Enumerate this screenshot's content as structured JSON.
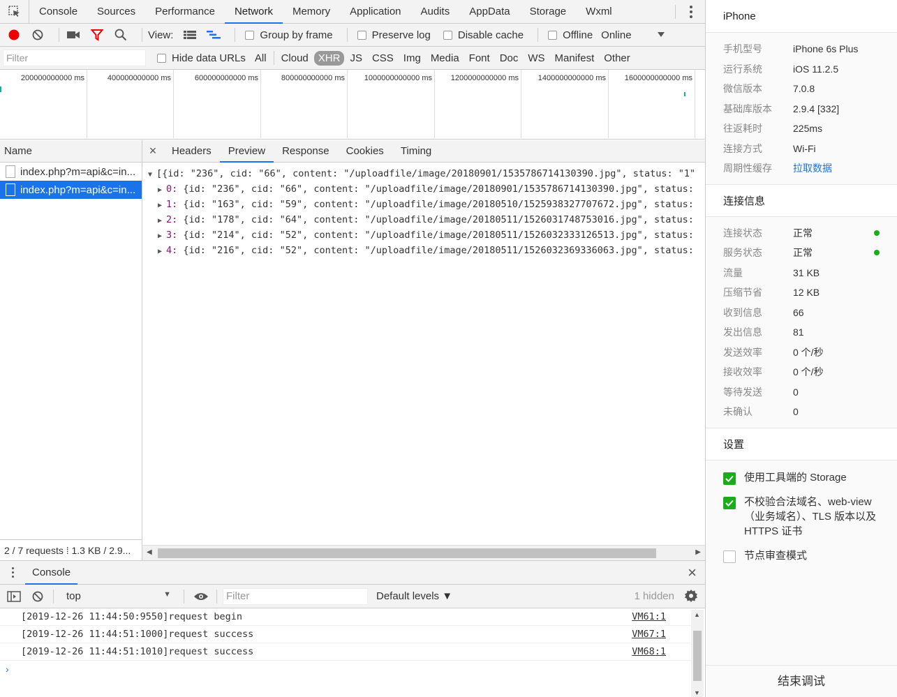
{
  "tabs": [
    "Console",
    "Sources",
    "Performance",
    "Network",
    "Memory",
    "Application",
    "Audits",
    "AppData",
    "Storage",
    "Wxml"
  ],
  "active_tab": "Network",
  "network_toolbar": {
    "view_label": "View:",
    "group_by_frame": "Group by frame",
    "preserve_log": "Preserve log",
    "disable_cache": "Disable cache",
    "offline": "Offline",
    "throttle": "Online"
  },
  "filter_row": {
    "placeholder": "Filter",
    "hide_data_urls": "Hide data URLs",
    "types": [
      "All",
      "Cloud",
      "XHR",
      "JS",
      "CSS",
      "Img",
      "Media",
      "Font",
      "Doc",
      "WS",
      "Manifest",
      "Other"
    ],
    "active_type": "XHR"
  },
  "overview_ticks": [
    "200000000000 ms",
    "400000000000 ms",
    "600000000000 ms",
    "800000000000 ms",
    "1000000000000 ms",
    "1200000000000 ms",
    "1400000000000 ms",
    "1600000000000 ms"
  ],
  "request_list": {
    "header": "Name",
    "items": [
      "index.php?m=api&c=in...",
      "index.php?m=api&c=in..."
    ],
    "status": "2 / 7 requests  ⁞  1.3 KB / 2.9..."
  },
  "detail_tabs": [
    "Headers",
    "Preview",
    "Response",
    "Cookies",
    "Timing"
  ],
  "active_detail_tab": "Preview",
  "preview": {
    "root": "[{id: \"236\", cid: \"66\", content: \"/uploadfile/image/20180901/1535786714130390.jpg\", status: \"1\"",
    "items": [
      {
        "idx": "0:",
        "text": " {id: \"236\", cid: \"66\", content: \"/uploadfile/image/20180901/1535786714130390.jpg\", status:"
      },
      {
        "idx": "1:",
        "text": " {id: \"163\", cid: \"59\", content: \"/uploadfile/image/20180510/1525938327707672.jpg\", status:"
      },
      {
        "idx": "2:",
        "text": " {id: \"178\", cid: \"64\", content: \"/uploadfile/image/20180511/1526031748753016.jpg\", status:"
      },
      {
        "idx": "3:",
        "text": " {id: \"214\", cid: \"52\", content: \"/uploadfile/image/20180511/1526032333126513.jpg\", status:"
      },
      {
        "idx": "4:",
        "text": " {id: \"216\", cid: \"52\", content: \"/uploadfile/image/20180511/1526032369336063.jpg\", status:"
      }
    ]
  },
  "console": {
    "tab": "Console",
    "context": "top",
    "filter_placeholder": "Filter",
    "levels": "Default levels ▼",
    "hidden": "1 hidden",
    "logs": [
      {
        "text": "[2019-12-26 11:44:50:9550]request begin",
        "src": "VM61:1"
      },
      {
        "text": "[2019-12-26 11:44:51:1000]request success",
        "src": "VM67:1"
      },
      {
        "text": "[2019-12-26 11:44:51:1010]request success",
        "src": "VM68:1"
      }
    ],
    "prompt": "›"
  },
  "side": {
    "device_title": "iPhone",
    "device_info": [
      {
        "k": "手机型号",
        "v": "iPhone 6s Plus"
      },
      {
        "k": "运行系统",
        "v": "iOS 11.2.5"
      },
      {
        "k": "微信版本",
        "v": "7.0.8"
      },
      {
        "k": "基础库版本",
        "v": "2.9.4 [332]"
      },
      {
        "k": "往返耗时",
        "v": "225ms"
      },
      {
        "k": "连接方式",
        "v": "Wi-Fi"
      },
      {
        "k": "周期性缓存",
        "v": "拉取数据"
      }
    ],
    "conn_title": "连接信息",
    "conn_info": [
      {
        "k": "连接状态",
        "v": "正常"
      },
      {
        "k": "服务状态",
        "v": "正常"
      },
      {
        "k": "流量",
        "v": "31 KB"
      },
      {
        "k": "压缩节省",
        "v": "12 KB"
      },
      {
        "k": "收到信息",
        "v": "66"
      },
      {
        "k": "发出信息",
        "v": "81"
      },
      {
        "k": "发送效率",
        "v": "0 个/秒"
      },
      {
        "k": "接收效率",
        "v": "0 个/秒"
      },
      {
        "k": "等待发送",
        "v": "0"
      },
      {
        "k": "未确认",
        "v": "0"
      }
    ],
    "settings_title": "设置",
    "settings": [
      {
        "label": "使用工具端的 Storage",
        "checked": true
      },
      {
        "label": "不校验合法域名、web-view（业务域名）、TLS 版本以及 HTTPS 证书",
        "checked": true
      },
      {
        "label": "节点审查模式",
        "checked": false
      }
    ],
    "end_button": "结束调试",
    "status_color": "#1aad19",
    "accent_color": "#1a73e8"
  }
}
